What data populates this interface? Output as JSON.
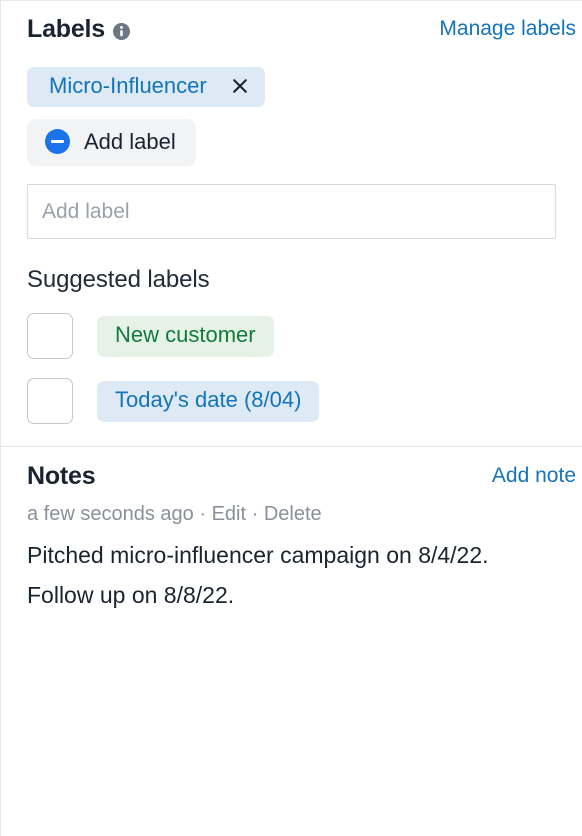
{
  "labels_section": {
    "title": "Labels",
    "info_icon": "info-icon",
    "manage_link": "Manage labels",
    "applied_labels": [
      {
        "text": "Micro-Influencer",
        "remove_icon": "close-icon"
      }
    ],
    "add_label_button": {
      "icon": "minus-circle-icon",
      "label": "Add label"
    },
    "add_label_input": {
      "value": "",
      "placeholder": "Add label"
    },
    "suggested_title": "Suggested labels",
    "suggested_labels": [
      {
        "text": "New customer",
        "checked": false,
        "style": "green"
      },
      {
        "text": "Today's date (8/04)",
        "checked": false,
        "style": "blue"
      }
    ]
  },
  "notes_section": {
    "title": "Notes",
    "add_note_link": "Add note",
    "note": {
      "timestamp": "a few seconds ago",
      "separator_1": "·",
      "edit_label": "Edit",
      "separator_2": "·",
      "delete_label": "Delete",
      "body": "Pitched micro-influencer campaign on 8/4/22. Follow up on 8/8/22."
    }
  },
  "colors": {
    "link_blue": "#1474b8",
    "chip_blue_bg": "#ddeaf6",
    "chip_green_bg": "#e6f2e6",
    "chip_green_text": "#12793f",
    "icon_blue": "#1a73e8",
    "muted_text": "#8a9099"
  }
}
